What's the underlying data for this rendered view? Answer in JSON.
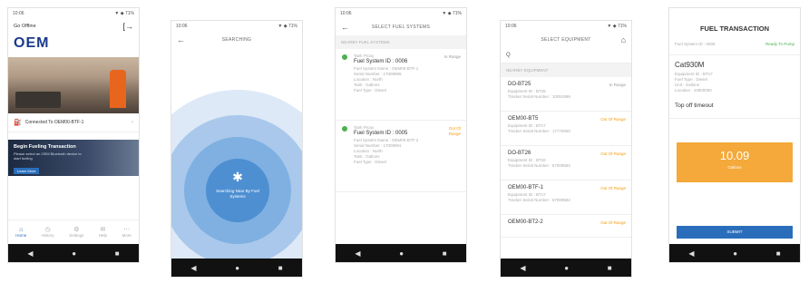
{
  "nav_icons": [
    "back-triangle",
    "home-circle",
    "recent-square"
  ],
  "nav_glyphs": {
    "back": "◀",
    "home": "●",
    "recent": "■"
  },
  "colors": {
    "accent_blue": "#2a6ebb",
    "orange": "#f4a93a",
    "green": "#4caf50",
    "red": "#e74c3c"
  },
  "phone1": {
    "status_time": "10:06",
    "status_icons": "▼ ◆ 71%",
    "title": "Go Offline",
    "logo": "OEM",
    "connected_text": "Connected To OEM00-BTF-1",
    "promo_title": "Begin Fueling Transaction",
    "promo_sub": "Please select an OEM Bluetooth device to start fueling",
    "promo_link": "Learn More",
    "tabs": [
      "Home",
      "History",
      "Settings",
      "Help",
      "More"
    ]
  },
  "phone2": {
    "status_time": "10:06",
    "status_icons": "▼ ◆ 71%",
    "title": "SEARCHING",
    "scan_text": "Searching Near By Fuel Systems"
  },
  "phone3": {
    "status_time": "10:06",
    "status_icons": "▼ ◆ 71%",
    "title": "SELECT FUEL SYSTEMS",
    "section": "NEARBY FUEL SYSTEMS",
    "systems": [
      {
        "type": "Tank Proxy",
        "name": "Fuel System ID : 0006",
        "status": "In Range",
        "details": [
          "Fuel System Name : OEM00-BTF-1",
          "Serial Number : 17009999",
          "Location : North",
          "Tank : Gallons",
          "Fuel Type : Diesel"
        ]
      },
      {
        "type": "Tank Proxy",
        "name": "Fuel System ID : 0005",
        "status": "Out Of Range",
        "details": [
          "Fuel System Name : OEM00-BTF-2",
          "Serial Number : 17009991",
          "Location : North",
          "Tank : Gallons",
          "Fuel Type : Diesel"
        ]
      }
    ]
  },
  "phone4": {
    "status_time": "10:06",
    "status_icons": "▼ ◆ 71%",
    "title": "SELECT EQUIPMENT",
    "search_value": "Q",
    "section": "NEARBY EQUIPMENT",
    "equipment": [
      {
        "name": "DO-BT25",
        "status": "In Range",
        "d1": "Equipment ID : BT25",
        "d2": "Tracker Serial Number : 10051999"
      },
      {
        "name": "OEM00-BT5",
        "status": "Out Of Range",
        "d1": "Equipment ID : BT17",
        "d2": "Tracker Serial Number : 17770050"
      },
      {
        "name": "DO-BT26",
        "status": "Out Of Range",
        "d1": "Equipment ID : BT26",
        "d2": "Tracker Serial Number : 57009582"
      },
      {
        "name": "OEM00-BTF-1",
        "status": "Out Of Range",
        "d1": "Equipment ID : BT17",
        "d2": "Tracker Serial Number : 57009582"
      },
      {
        "name": "OEM00-BT2-2",
        "status": "Out Of Range",
        "d1": "",
        "d2": ""
      }
    ]
  },
  "phone5": {
    "title": "FUEL TRANSACTION",
    "sub_left": "Fuel System ID : 0006",
    "sub_right": "Ready To Pump",
    "vehicle": "Cat930M",
    "details": [
      "Equipment ID : BT17",
      "Fuel Type : Diesel",
      "Unit : Gallons",
      "Location : 10900000"
    ],
    "timeout": "Top off timeout",
    "amount": "10.09",
    "amount_unit": "Gallons",
    "submit": "SUBMIT"
  }
}
